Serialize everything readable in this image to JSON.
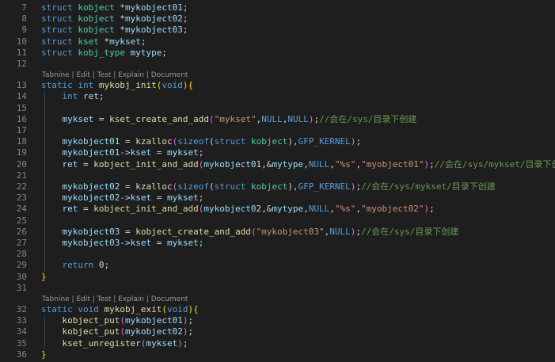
{
  "colors": {
    "background": "#1e1e1e",
    "line_number": "#858585",
    "keyword": "#569cd6",
    "type": "#4ec9b0",
    "variable": "#9cdcfe",
    "function": "#dcdcaa",
    "string": "#ce9178",
    "comment": "#6a9955",
    "bracket_gold": "#ffd700",
    "bracket_purple": "#da70d6",
    "codelens": "#999999"
  },
  "codelens": {
    "init": "Tabnine | Edit | Test | Explain | Document",
    "exit": "Tabnine | Edit | Test | Explain | Document"
  },
  "lines": [
    {
      "n": "7",
      "tokens": [
        [
          "kw",
          "struct"
        ],
        [
          "df",
          " "
        ],
        [
          "ty",
          "kobject"
        ],
        [
          "df",
          " *"
        ],
        [
          "vr",
          "mykobject01"
        ],
        [
          "df",
          ";"
        ]
      ]
    },
    {
      "n": "8",
      "tokens": [
        [
          "kw",
          "struct"
        ],
        [
          "df",
          " "
        ],
        [
          "ty",
          "kobject"
        ],
        [
          "df",
          " *"
        ],
        [
          "vr",
          "mykobject02"
        ],
        [
          "df",
          ";"
        ]
      ]
    },
    {
      "n": "9",
      "tokens": [
        [
          "kw",
          "struct"
        ],
        [
          "df",
          " "
        ],
        [
          "ty",
          "kobject"
        ],
        [
          "df",
          " *"
        ],
        [
          "vr",
          "mykobject03"
        ],
        [
          "df",
          ";"
        ]
      ]
    },
    {
      "n": "10",
      "tokens": [
        [
          "kw",
          "struct"
        ],
        [
          "df",
          " "
        ],
        [
          "ty",
          "kset"
        ],
        [
          "df",
          " *"
        ],
        [
          "vr",
          "mykset"
        ],
        [
          "df",
          ";"
        ]
      ]
    },
    {
      "n": "11",
      "tokens": [
        [
          "kw",
          "struct"
        ],
        [
          "df",
          " "
        ],
        [
          "ty",
          "kobj_type"
        ],
        [
          "df",
          " "
        ],
        [
          "vr",
          "mytype"
        ],
        [
          "df",
          ";"
        ]
      ]
    },
    {
      "n": "12",
      "tokens": []
    },
    {
      "n": "13",
      "lens": "init",
      "tokens": [
        [
          "kw",
          "static"
        ],
        [
          "df",
          " "
        ],
        [
          "kw",
          "int"
        ],
        [
          "df",
          " "
        ],
        [
          "fn",
          "mykobj_init"
        ],
        [
          "bk",
          "("
        ],
        [
          "kw",
          "void"
        ],
        [
          "bk",
          ")"
        ],
        [
          "bk",
          "{"
        ]
      ]
    },
    {
      "n": "14",
      "tokens": [
        [
          "df",
          "    "
        ],
        [
          "kw",
          "int"
        ],
        [
          "df",
          " "
        ],
        [
          "vr",
          "ret"
        ],
        [
          "df",
          ";"
        ]
      ]
    },
    {
      "n": "15",
      "tokens": []
    },
    {
      "n": "16",
      "tokens": [
        [
          "df",
          "    "
        ],
        [
          "vr",
          "mykset"
        ],
        [
          "df",
          " = "
        ],
        [
          "fn",
          "kset_create_and_add"
        ],
        [
          "bp",
          "("
        ],
        [
          "st",
          "\"mykset\""
        ],
        [
          "df",
          ","
        ],
        [
          "kw",
          "NULL"
        ],
        [
          "df",
          ","
        ],
        [
          "kw",
          "NULL"
        ],
        [
          "bp",
          ")"
        ],
        [
          "df",
          ";"
        ],
        [
          "cm",
          "//会在/sys/目录下创建"
        ]
      ]
    },
    {
      "n": "17",
      "tokens": []
    },
    {
      "n": "18",
      "tokens": [
        [
          "df",
          "    "
        ],
        [
          "vr",
          "mykobject01"
        ],
        [
          "df",
          " = "
        ],
        [
          "fn",
          "kzalloc"
        ],
        [
          "bp",
          "("
        ],
        [
          "kw",
          "sizeof"
        ],
        [
          "df",
          "("
        ],
        [
          "kw",
          "struct"
        ],
        [
          "df",
          " "
        ],
        [
          "ty",
          "kobject"
        ],
        [
          "df",
          ")"
        ],
        [
          "df",
          ","
        ],
        [
          "kw",
          "GFP_KERNEL"
        ],
        [
          "bp",
          ")"
        ],
        [
          "df",
          ";"
        ]
      ]
    },
    {
      "n": "19",
      "tokens": [
        [
          "df",
          "    "
        ],
        [
          "vr",
          "mykobject01"
        ],
        [
          "df",
          "->"
        ],
        [
          "vr",
          "kset"
        ],
        [
          "df",
          " = "
        ],
        [
          "vr",
          "mykset"
        ],
        [
          "df",
          ";"
        ]
      ]
    },
    {
      "n": "20",
      "tokens": [
        [
          "df",
          "    "
        ],
        [
          "vr",
          "ret"
        ],
        [
          "df",
          " = "
        ],
        [
          "fn",
          "kobject_init_and_add"
        ],
        [
          "bp",
          "("
        ],
        [
          "vr",
          "mykobject01"
        ],
        [
          "df",
          ",&"
        ],
        [
          "vr",
          "mytype"
        ],
        [
          "df",
          ","
        ],
        [
          "kw",
          "NULL"
        ],
        [
          "df",
          ","
        ],
        [
          "st",
          "\"%s\""
        ],
        [
          "df",
          ","
        ],
        [
          "st",
          "\"myobject01\""
        ],
        [
          "bp",
          ")"
        ],
        [
          "df",
          ";"
        ],
        [
          "cm",
          "//会在/sys/mykset/目录下创建"
        ]
      ]
    },
    {
      "n": "21",
      "tokens": []
    },
    {
      "n": "22",
      "tokens": [
        [
          "df",
          "    "
        ],
        [
          "vr",
          "mykobject02"
        ],
        [
          "df",
          " = "
        ],
        [
          "fn",
          "kzalloc"
        ],
        [
          "bp",
          "("
        ],
        [
          "kw",
          "sizeof"
        ],
        [
          "df",
          "("
        ],
        [
          "kw",
          "struct"
        ],
        [
          "df",
          " "
        ],
        [
          "ty",
          "kobject"
        ],
        [
          "df",
          ")"
        ],
        [
          "df",
          ","
        ],
        [
          "kw",
          "GFP_KERNEL"
        ],
        [
          "bp",
          ")"
        ],
        [
          "df",
          ";"
        ],
        [
          "cm",
          "//会在/sys/mykset/目录下创建"
        ]
      ]
    },
    {
      "n": "23",
      "tokens": [
        [
          "df",
          "    "
        ],
        [
          "vr",
          "mykobject02"
        ],
        [
          "df",
          "->"
        ],
        [
          "vr",
          "kset"
        ],
        [
          "df",
          " = "
        ],
        [
          "vr",
          "mykset"
        ],
        [
          "df",
          ";"
        ]
      ]
    },
    {
      "n": "24",
      "tokens": [
        [
          "df",
          "    "
        ],
        [
          "vr",
          "ret"
        ],
        [
          "df",
          " = "
        ],
        [
          "fn",
          "kobject_init_and_add"
        ],
        [
          "bp",
          "("
        ],
        [
          "vr",
          "mykobject02"
        ],
        [
          "df",
          ",&"
        ],
        [
          "vr",
          "mytype"
        ],
        [
          "df",
          ","
        ],
        [
          "kw",
          "NULL"
        ],
        [
          "df",
          ","
        ],
        [
          "st",
          "\"%s\""
        ],
        [
          "df",
          ","
        ],
        [
          "st",
          "\"myobject02\""
        ],
        [
          "bp",
          ")"
        ],
        [
          "df",
          ";"
        ]
      ]
    },
    {
      "n": "25",
      "tokens": []
    },
    {
      "n": "26",
      "tokens": [
        [
          "df",
          "    "
        ],
        [
          "vr",
          "mykobject03"
        ],
        [
          "df",
          " = "
        ],
        [
          "fn",
          "kobject_create_and_add"
        ],
        [
          "bp",
          "("
        ],
        [
          "st",
          "\"mykobject03\""
        ],
        [
          "df",
          ","
        ],
        [
          "kw",
          "NULL"
        ],
        [
          "bp",
          ")"
        ],
        [
          "df",
          ";"
        ],
        [
          "cm",
          "//会在/sys/目录下创建"
        ]
      ]
    },
    {
      "n": "27",
      "tokens": [
        [
          "df",
          "    "
        ],
        [
          "vr",
          "mykobject03"
        ],
        [
          "df",
          "->"
        ],
        [
          "vr",
          "kset"
        ],
        [
          "df",
          " = "
        ],
        [
          "vr",
          "mykset"
        ],
        [
          "df",
          ";"
        ]
      ]
    },
    {
      "n": "28",
      "tokens": []
    },
    {
      "n": "29",
      "tokens": [
        [
          "df",
          "    "
        ],
        [
          "kw",
          "return"
        ],
        [
          "df",
          " 0;"
        ]
      ]
    },
    {
      "n": "30",
      "tokens": [
        [
          "bk",
          "}"
        ]
      ]
    },
    {
      "n": "31",
      "tokens": []
    },
    {
      "n": "32",
      "lens": "exit",
      "tokens": [
        [
          "kw",
          "static"
        ],
        [
          "df",
          " "
        ],
        [
          "kw",
          "void"
        ],
        [
          "df",
          " "
        ],
        [
          "fn",
          "mykobj_exit"
        ],
        [
          "bk",
          "("
        ],
        [
          "kw",
          "void"
        ],
        [
          "bk",
          ")"
        ],
        [
          "bk",
          "{"
        ]
      ]
    },
    {
      "n": "33",
      "tokens": [
        [
          "df",
          "    "
        ],
        [
          "fn",
          "kobject_put"
        ],
        [
          "bp",
          "("
        ],
        [
          "vr",
          "mykobject01"
        ],
        [
          "bp",
          ")"
        ],
        [
          "df",
          ";"
        ]
      ]
    },
    {
      "n": "34",
      "tokens": [
        [
          "df",
          "    "
        ],
        [
          "fn",
          "kobject_put"
        ],
        [
          "bp",
          "("
        ],
        [
          "vr",
          "mykobject02"
        ],
        [
          "bp",
          ")"
        ],
        [
          "df",
          ";"
        ]
      ]
    },
    {
      "n": "35",
      "tokens": [
        [
          "df",
          "    "
        ],
        [
          "fn",
          "kset_unregister"
        ],
        [
          "bp",
          "("
        ],
        [
          "vr",
          "mykset"
        ],
        [
          "bp",
          ")"
        ],
        [
          "df",
          ";"
        ]
      ]
    },
    {
      "n": "36",
      "tokens": [
        [
          "bk",
          "}"
        ]
      ]
    }
  ]
}
